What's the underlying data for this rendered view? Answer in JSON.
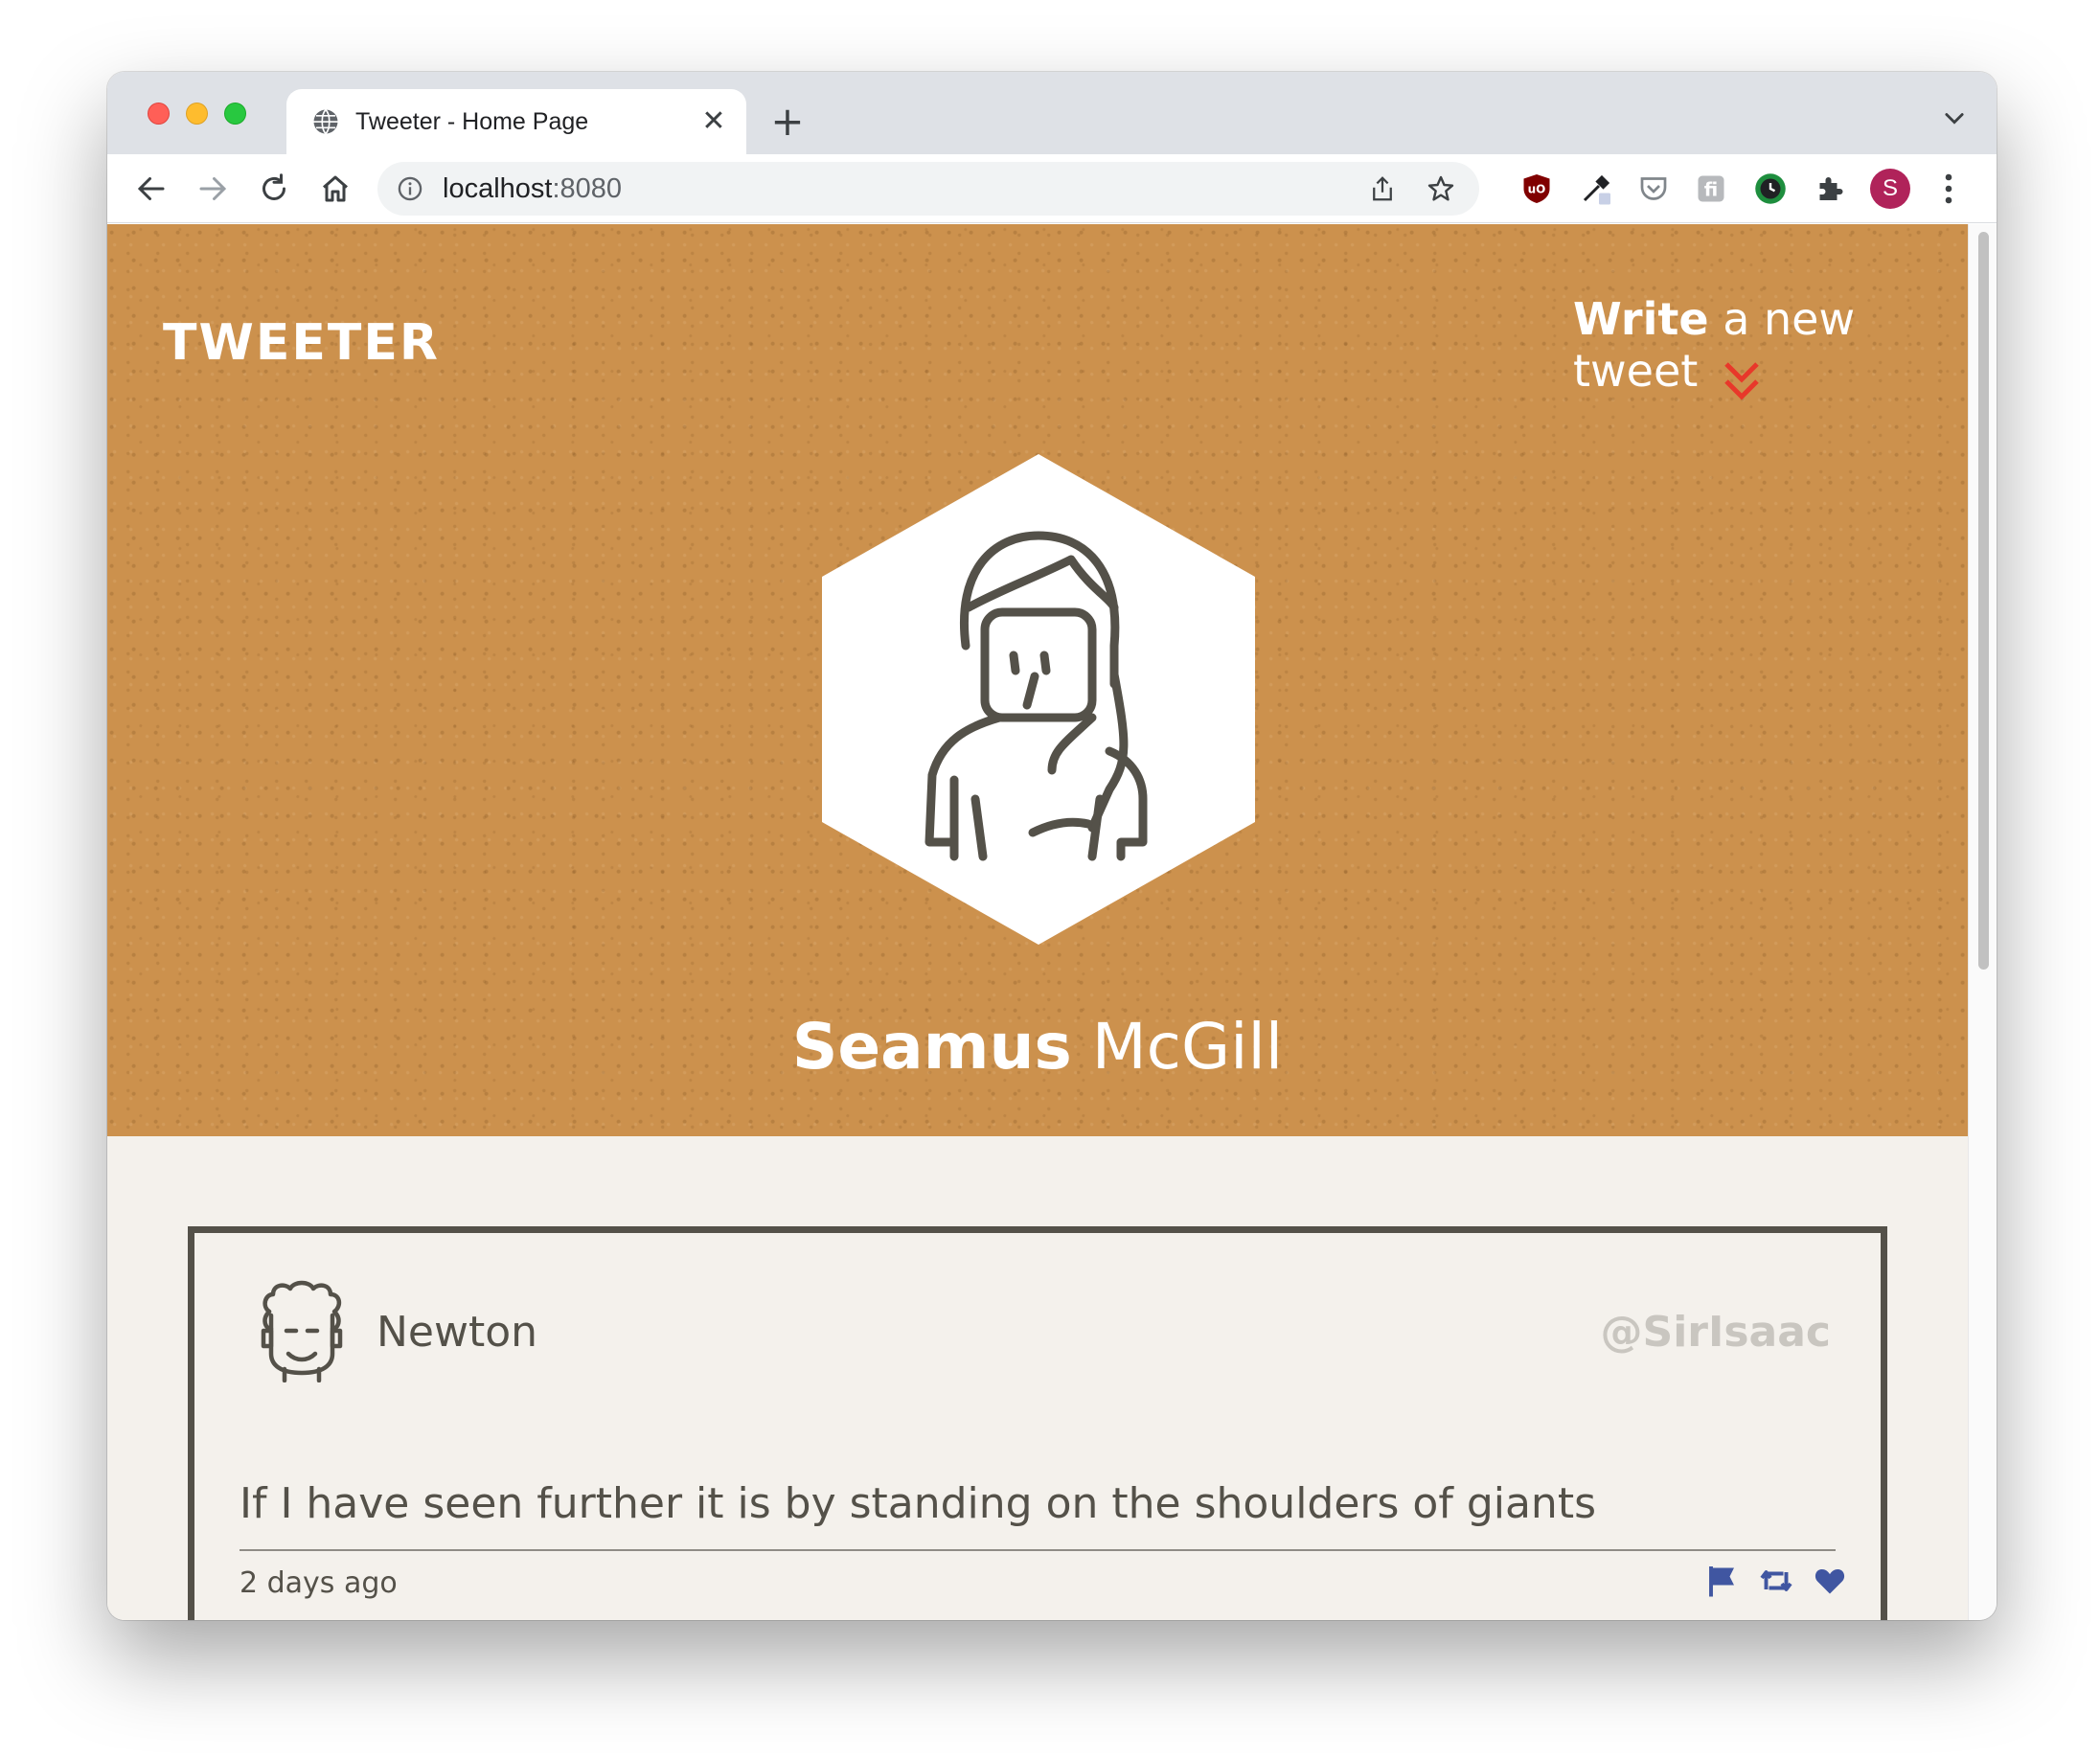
{
  "browser": {
    "tab_title": "Tweeter - Home Page",
    "tab_close_glyph": "✕",
    "new_tab_glyph": "+",
    "url_host": "localhost",
    "url_port": ":8080",
    "profile_initial": "S",
    "icons": [
      "globe-icon",
      "back-arrow-icon",
      "forward-arrow-icon",
      "reload-icon",
      "home-icon",
      "info-icon",
      "share-icon",
      "star-icon",
      "ublock-icon",
      "eyedropper-icon",
      "pocket-icon",
      "extension-icon",
      "clock-icon",
      "puzzle-icon",
      "kebab-menu-icon",
      "chevron-down-icon"
    ]
  },
  "header": {
    "logo": "TWEETER",
    "write_bold": "Write",
    "write_rest": " a new tweet",
    "colors": {
      "hero_bg": "#cc914d",
      "chevron": "#e8382a"
    }
  },
  "profile": {
    "first_name": "Seamus",
    "last_name": " McGill"
  },
  "tweets": [
    {
      "name": "Newton",
      "handle": "@SirIsaac",
      "text": "If I have seen further it is by standing on the shoulders of giants",
      "time": "2 days ago",
      "actions": [
        "flag-icon",
        "retweet-icon",
        "heart-icon"
      ],
      "action_color": "#4056a1"
    }
  ]
}
